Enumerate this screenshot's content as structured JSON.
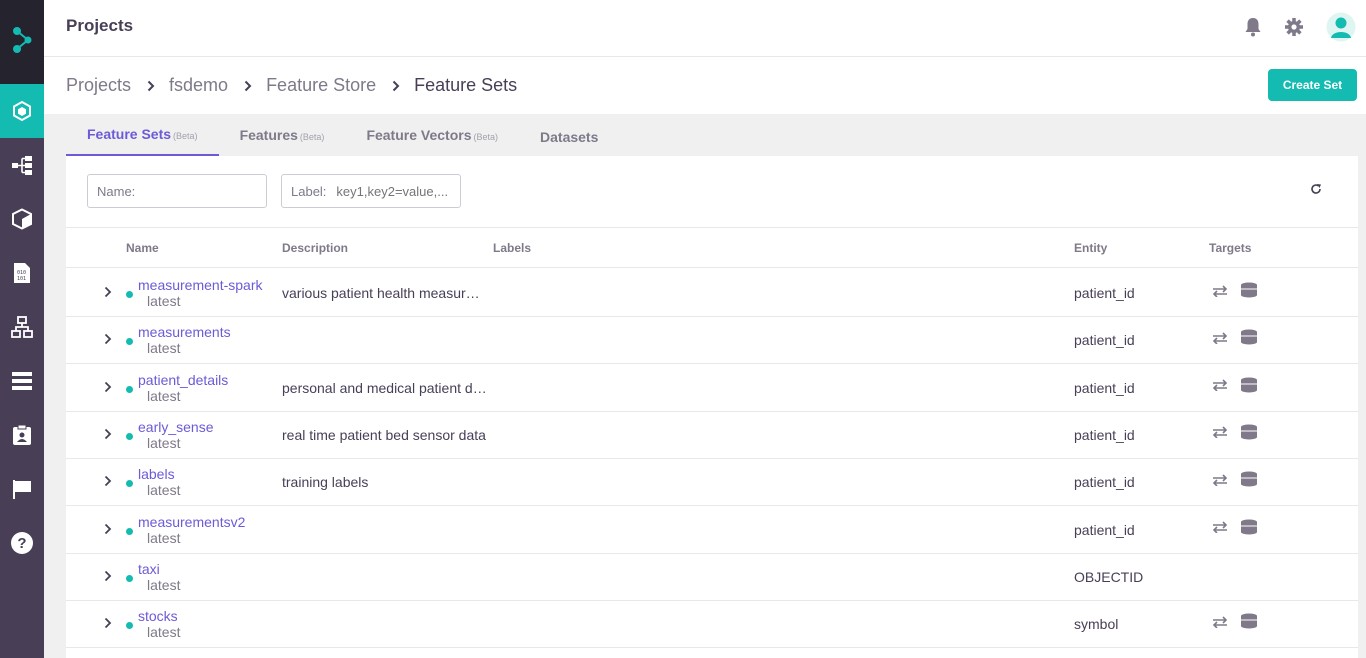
{
  "header": {
    "title": "Projects"
  },
  "breadcrumbs": [
    "Projects",
    "fsdemo",
    "Feature Store",
    "Feature Sets"
  ],
  "actions": {
    "create_label": "Create Set"
  },
  "tabs": [
    {
      "label": "Feature Sets",
      "badge": "(Beta)"
    },
    {
      "label": "Features",
      "badge": "(Beta)"
    },
    {
      "label": "Feature Vectors",
      "badge": "(Beta)"
    },
    {
      "label": "Datasets",
      "badge": ""
    }
  ],
  "filters": {
    "name_label": "Name:",
    "label_label": "Label:",
    "label_placeholder": "key1,key2=value,..."
  },
  "table": {
    "columns": [
      "Name",
      "Description",
      "Labels",
      "Entity",
      "Targets"
    ],
    "rows": [
      {
        "name": "measurement-spark",
        "tag": "latest",
        "description": "various patient health measure…",
        "entity": "patient_id",
        "targets": true
      },
      {
        "name": "measurements",
        "tag": "latest",
        "description": "",
        "entity": "patient_id",
        "targets": true
      },
      {
        "name": "patient_details",
        "tag": "latest",
        "description": "personal and medical patient de…",
        "entity": "patient_id",
        "targets": true
      },
      {
        "name": "early_sense",
        "tag": "latest",
        "description": "real time patient bed sensor data",
        "entity": "patient_id",
        "targets": true
      },
      {
        "name": "labels",
        "tag": "latest",
        "description": "training labels",
        "entity": "patient_id",
        "targets": true
      },
      {
        "name": "measurementsv2",
        "tag": "latest",
        "description": "",
        "entity": "patient_id",
        "targets": true
      },
      {
        "name": "taxi",
        "tag": "latest",
        "description": "",
        "entity": "OBJECTID",
        "targets": false
      },
      {
        "name": "stocks",
        "tag": "latest",
        "description": "",
        "entity": "symbol",
        "targets": true
      }
    ]
  },
  "colors": {
    "accent": "#13bbb1",
    "link": "#6b5bd6",
    "sidebar": "#483f56"
  },
  "icons": [
    "bell-icon",
    "gear-icon",
    "user-avatar-icon",
    "refresh-icon",
    "chevron-right-icon",
    "arrows-swap-icon",
    "database-icon"
  ]
}
